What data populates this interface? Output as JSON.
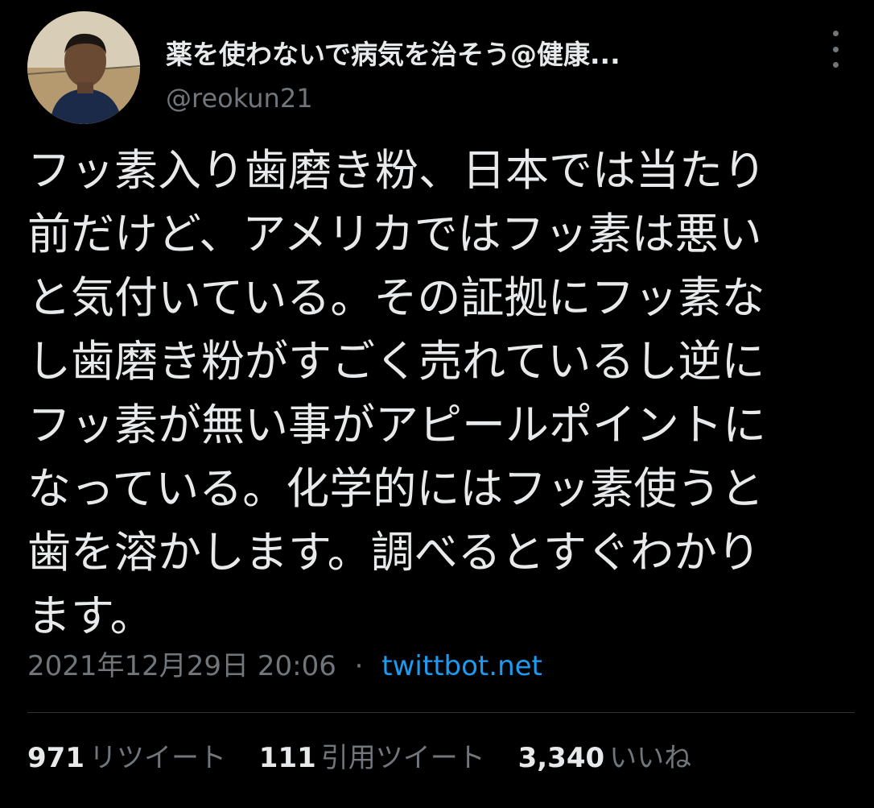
{
  "author": {
    "display_name": "薬を使わないで病気を治そう@健康...",
    "handle": "@reokun21"
  },
  "tweet": {
    "lines": [
      "フッ素入り歯磨き粉、日本では当たり",
      "前だけど、アメリカではフッ素は悪い",
      "と気付いている。その証拠にフッ素な",
      "し歯磨き粉がすごく売れているし逆に",
      "フッ素が無い事がアピールポイントに",
      "なっている。化学的にはフッ素使うと",
      "歯を溶かします。調べるとすぐわかり",
      "ます。"
    ],
    "timestamp": "2021年12月29日 20:06",
    "separator": "·",
    "source": "twittbot.net"
  },
  "stats": {
    "retweets_count": "971",
    "retweets_label": "リツイート",
    "quotes_count": "111",
    "quotes_label": "引用ツイート",
    "likes_count": "3,340",
    "likes_label": "いいね"
  },
  "colors": {
    "background": "#000000",
    "text": "#e7e9ea",
    "secondary": "#71767b",
    "link": "#1d9bf0",
    "divider": "#2f3336"
  },
  "icons": {
    "more": "more-vertical-icon",
    "avatar": "avatar-photo"
  }
}
